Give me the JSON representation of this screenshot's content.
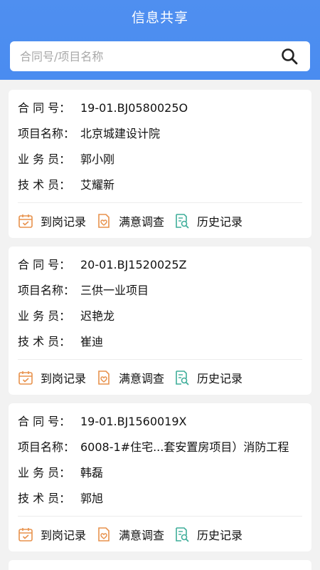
{
  "header": {
    "title": "信息共享"
  },
  "search": {
    "placeholder": "合同号/项目名称",
    "value": ""
  },
  "labels": {
    "contract": "合 同 号：",
    "project": "项目名称：",
    "salesman": "业 务 员：",
    "technician": "技 术 员："
  },
  "actions": {
    "arrival": "到岗记录",
    "survey": "满意调查",
    "history": "历史记录"
  },
  "records": [
    {
      "contract": "19-01.BJ0580025O",
      "project": "北京城建设计院",
      "salesman": "郭小刚",
      "technician": "艾耀新"
    },
    {
      "contract": "20-01.BJ1520025Z",
      "project": "三供一业项目",
      "salesman": "迟艳龙",
      "technician": "崔迪"
    },
    {
      "contract": "19-01.BJ1560019X",
      "project": "6008-1#住宅...套安置房项目）消防工程",
      "salesman": "韩磊",
      "technician": "郭旭"
    }
  ],
  "colors": {
    "header": "#4a8cf0",
    "icon_orange": "#e8924d",
    "icon_teal": "#3fae9a"
  },
  "icons": {
    "search": "search-icon",
    "arrival": "calendar-check-icon",
    "survey": "clipboard-heart-icon",
    "history": "document-search-icon"
  }
}
